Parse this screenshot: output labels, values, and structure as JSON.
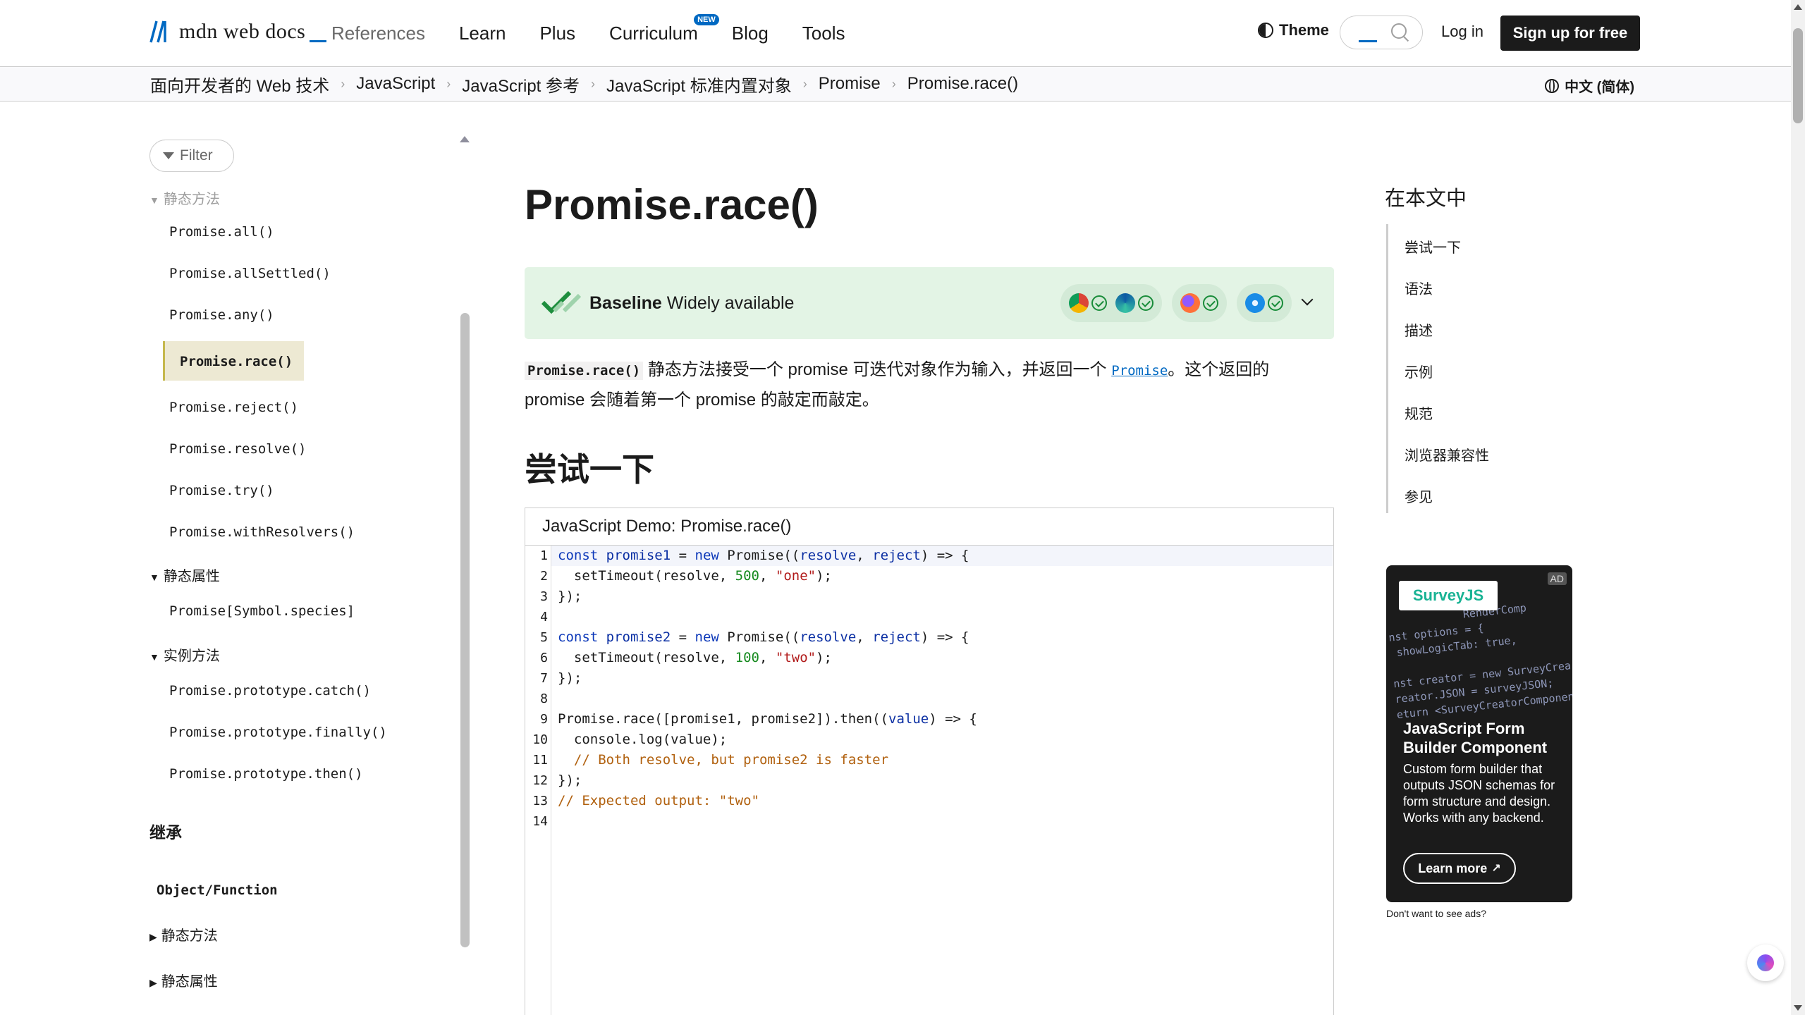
{
  "header": {
    "logo_text": "mdn web docs",
    "nav": [
      "References",
      "Learn",
      "Plus",
      "Curriculum",
      "Blog",
      "Tools"
    ],
    "new_badge": "NEW",
    "theme_label": "Theme",
    "login_label": "Log in",
    "signup_label": "Sign up for free"
  },
  "breadcrumbs": [
    "面向开发者的 Web 技术",
    "JavaScript",
    "JavaScript 参考",
    "JavaScript 标准内置对象",
    "Promise",
    "Promise.race()"
  ],
  "language": "中文 (简体)",
  "sidebar": {
    "filter_placeholder": "Filter",
    "static_methods_heading": "静态方法",
    "static_methods": [
      "Promise.all()",
      "Promise.allSettled()",
      "Promise.any()",
      "Promise.race()",
      "Promise.reject()",
      "Promise.resolve()",
      "Promise.try()",
      "Promise.withResolvers()"
    ],
    "static_props_heading": "静态属性",
    "static_props": [
      "Promise[Symbol.species]"
    ],
    "instance_methods_heading": "实例方法",
    "instance_methods": [
      "Promise.prototype.catch()",
      "Promise.prototype.finally()",
      "Promise.prototype.then()"
    ],
    "inheritance_heading": "继承",
    "inheritance_item": "Object/Function",
    "inh_static_methods": "静态方法",
    "inh_static_props": "静态属性"
  },
  "main": {
    "title": "Promise.race()",
    "baseline_bold": "Baseline",
    "baseline_rest": "Widely available",
    "desc_code": "Promise.race()",
    "desc_text1": "静态方法接受一个 promise 可迭代对象作为输入，并返回一个",
    "desc_link": "Promise",
    "desc_text2": "。这个返回的",
    "desc_line2": "promise 会随着第一个 promise 的敲定而敲定。",
    "try_heading": "尝试一下",
    "demo_title": "JavaScript Demo: Promise.race()"
  },
  "toc": {
    "title": "在本文中",
    "items": [
      "尝试一下",
      "语法",
      "描述",
      "示例",
      "规范",
      "浏览器兼容性",
      "参见"
    ]
  },
  "ad": {
    "badge": "AD",
    "logo": "SurveyJS",
    "headline": "JavaScript Form Builder Component",
    "body": "Custom form builder that outputs JSON schemas for form structure and design. Works with any backend.",
    "button": "Learn more",
    "note": "Don't want to see ads?"
  },
  "colors": {
    "accent": "#0069c2",
    "baseline_bg": "#e3f4e5",
    "active_sidebar_bg": "#ede9d3"
  }
}
